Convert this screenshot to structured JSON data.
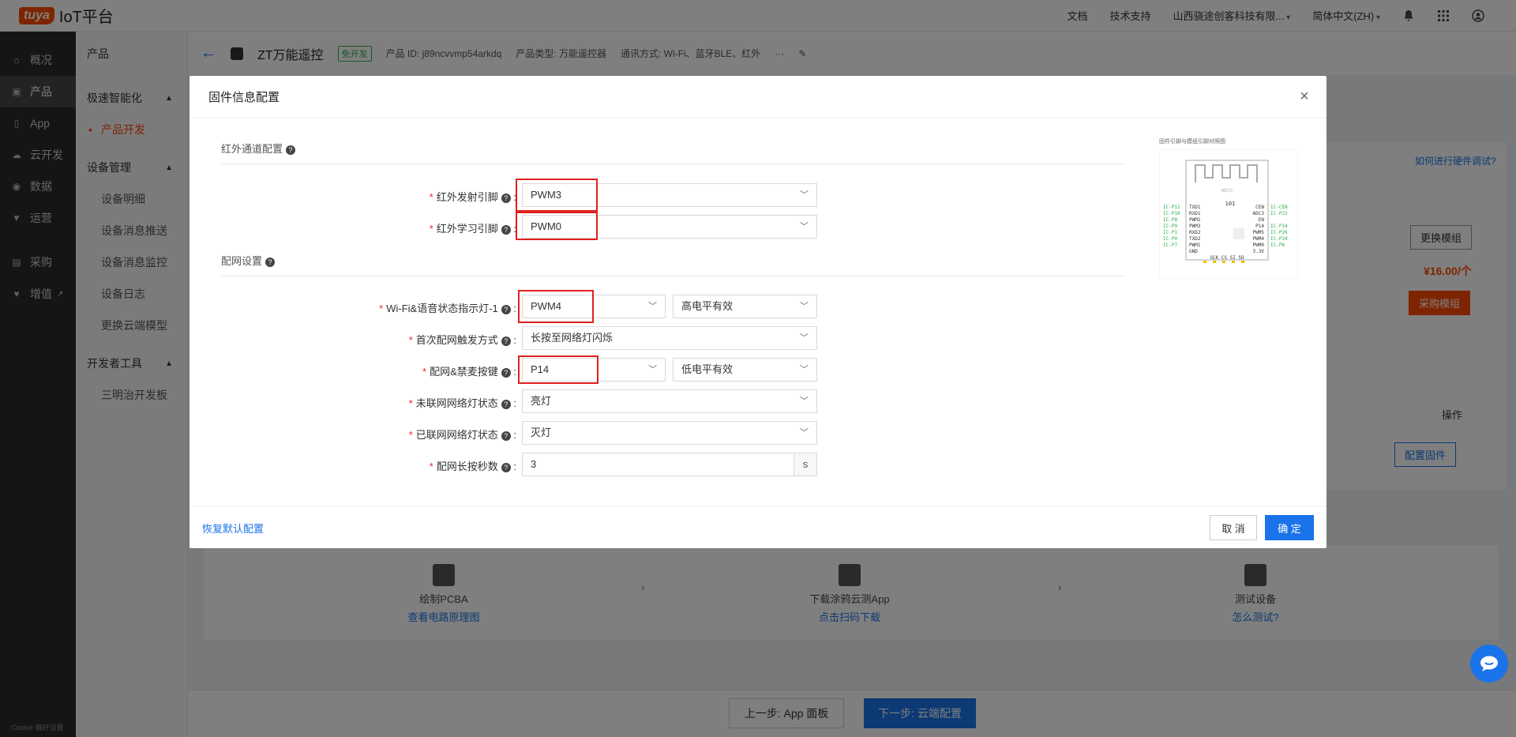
{
  "topbar": {
    "logo_badge": "tuya",
    "logo_text": "IoT平台",
    "links": [
      "文档",
      "技术支持",
      "山西骁途创客科技有限...",
      "简体中文(ZH)"
    ]
  },
  "leftnav": {
    "items": [
      "概况",
      "产品",
      "App",
      "云开发",
      "数据",
      "运营",
      "采购",
      "增值"
    ],
    "cookie": "Cookie 偏好设置"
  },
  "subnav": {
    "title": "产品",
    "groups": [
      {
        "label": "极速智能化",
        "items": [
          "产品开发"
        ]
      },
      {
        "label": "设备管理",
        "items": [
          "设备明细",
          "设备消息推送",
          "设备消息监控",
          "设备日志",
          "更换云端模型"
        ]
      },
      {
        "label": "开发者工具",
        "items": [
          "三明治开发板"
        ]
      }
    ]
  },
  "product": {
    "name": "ZT万能遥控",
    "tag": "免开发",
    "id": "产品 ID: j89ncvvmp54arkdq",
    "type": "产品类型: 万能遥控器",
    "comm": "通讯方式: Wi-Fi、蓝牙BLE、红外",
    "more": "···"
  },
  "background": {
    "hw_debug_link": "如何进行硬件调试?",
    "replace_module": "更换模组",
    "price": "¥16.00/个",
    "buy_module": "采购模组",
    "ops": "操作",
    "config_firmware": "配置固件",
    "steps": [
      {
        "title": "绘制PCBA",
        "link": "查看电路原理图"
      },
      {
        "title": "下载涂鸦云测App",
        "link": "点击扫码下载"
      },
      {
        "title": "测试设备",
        "link": "怎么测试?"
      }
    ],
    "prev_btn": "上一步: App 面板",
    "next_btn": "下一步: 云端配置"
  },
  "modal": {
    "title": "固件信息配置",
    "section1": "红外通道配置",
    "section2": "配网设置",
    "fields": {
      "ir_tx": {
        "label": "红外发射引脚",
        "value": "PWM3"
      },
      "ir_rx": {
        "label": "红外学习引脚",
        "value": "PWM0"
      },
      "led": {
        "label": "Wi-Fi&语音状态指示灯-1",
        "value": "PWM4",
        "level": "高电平有效"
      },
      "trigger": {
        "label": "首次配网触发方式",
        "value": "长按至网络灯闪烁"
      },
      "key": {
        "label": "配网&禁麦按键",
        "value": "P14",
        "level": "低电平有效"
      },
      "unconnected": {
        "label": "未联网网络灯状态",
        "value": "亮灯"
      },
      "connected": {
        "label": "已联网网络灯状态",
        "value": "灭灯"
      },
      "press_secs": {
        "label": "配网长按秒数",
        "value": "3",
        "unit": "s"
      }
    },
    "chip_caption": "固件引脚与模组引脚对照图",
    "chip": {
      "name": "WB3S",
      "center": "101",
      "left_pins": [
        "TXD1",
        "RXD1",
        "PWM2",
        "PWM3",
        "RXD2",
        "TXD2",
        "PWM1",
        "GND"
      ],
      "left_ios": [
        "IC-P11",
        "IC-P10",
        "IC-P8",
        "IC-P9",
        "IC-P1",
        "IC-P0",
        "IC-P7"
      ],
      "right_pins": [
        "CEN",
        "ADC3",
        "EN",
        "P14",
        "PWM5",
        "PWM4",
        "PWM0",
        "3.3V"
      ],
      "right_ios": [
        "IC-CEN",
        "IC-P23",
        "IC-P14",
        "IC-P26",
        "IC-P24",
        "IC-P6"
      ],
      "bottom": "SCK CS  SI SO"
    },
    "reset": "恢复默认配置",
    "cancel": "取 消",
    "ok": "确 定"
  }
}
